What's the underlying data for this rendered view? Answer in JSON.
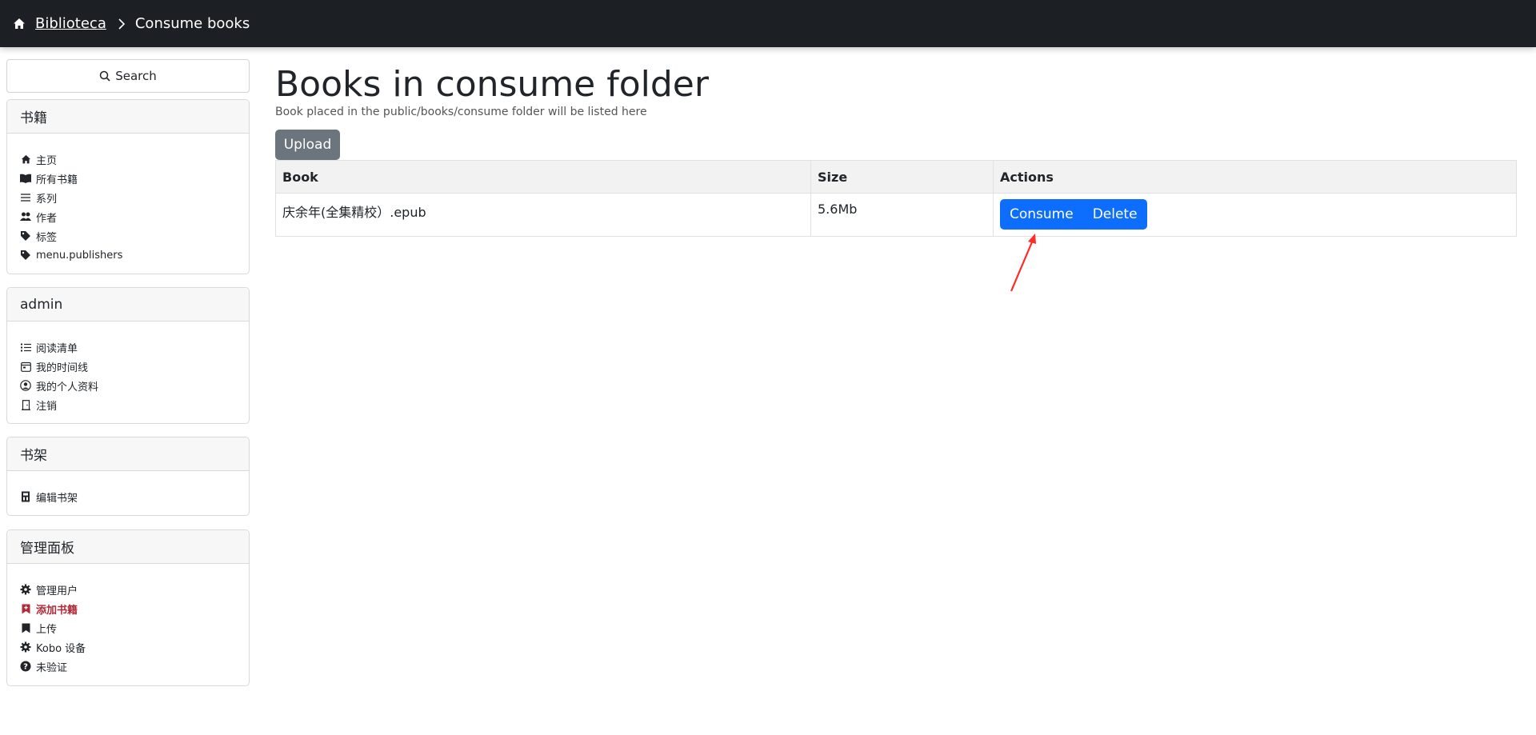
{
  "navbar": {
    "brand": "Biblioteca",
    "current": "Consume books"
  },
  "sidebar": {
    "search_label": "Search",
    "sections": [
      {
        "title": "书籍",
        "items": [
          {
            "label": "主页",
            "icon": "home-icon"
          },
          {
            "label": "所有书籍",
            "icon": "book-open-icon"
          },
          {
            "label": "系列",
            "icon": "list-icon"
          },
          {
            "label": "作者",
            "icon": "users-icon"
          },
          {
            "label": "标签",
            "icon": "tags-icon"
          },
          {
            "label": "menu.publishers",
            "icon": "tag-icon"
          }
        ]
      },
      {
        "title": "admin",
        "items": [
          {
            "label": "阅读清单",
            "icon": "list-check-icon"
          },
          {
            "label": "我的时间线",
            "icon": "calendar-icon"
          },
          {
            "label": "我的个人资料",
            "icon": "user-circle-icon"
          },
          {
            "label": "注销",
            "icon": "door-icon"
          }
        ]
      },
      {
        "title": "书架",
        "items": [
          {
            "label": "编辑书架",
            "icon": "bookshelf-icon"
          }
        ]
      },
      {
        "title": "管理面板",
        "items": [
          {
            "label": "管理用户",
            "icon": "gear-icon"
          },
          {
            "label": "添加书籍",
            "icon": "bookmark-plus-icon",
            "active": true
          },
          {
            "label": "上传",
            "icon": "bookmark-icon"
          },
          {
            "label": "Kobo 设备",
            "icon": "gear-icon"
          },
          {
            "label": "未验证",
            "icon": "question-icon"
          }
        ]
      }
    ]
  },
  "main": {
    "title": "Books in consume folder",
    "subtitle": "Book placed in the public/books/consume folder will be listed here",
    "upload_label": "Upload",
    "table": {
      "headers": [
        "Book",
        "Size",
        "Actions"
      ],
      "rows": [
        {
          "book": "庆余年(全集精校）.epub",
          "size": "5.6Mb",
          "consume_label": "Consume",
          "delete_label": "Delete"
        }
      ]
    }
  },
  "colors": {
    "navbar": "#1c1f23",
    "primary": "#0d6efd",
    "secondary": "#6c757d",
    "active_item": "#b02a37",
    "annotation": "#ff2a2a"
  }
}
